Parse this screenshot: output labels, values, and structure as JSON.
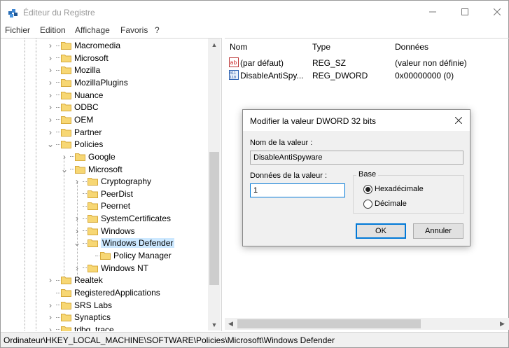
{
  "window": {
    "title": "Éditeur du Registre",
    "accent_color": "#0078d7"
  },
  "menu": [
    "Fichier",
    "Edition",
    "Affichage",
    "Favoris",
    "?"
  ],
  "tree": {
    "items": [
      {
        "label": "Macromedia",
        "expander": "collapsed"
      },
      {
        "label": "Microsoft",
        "expander": "collapsed"
      },
      {
        "label": "Mozilla",
        "expander": "collapsed"
      },
      {
        "label": "MozillaPlugins",
        "expander": "collapsed"
      },
      {
        "label": "Nuance",
        "expander": "collapsed"
      },
      {
        "label": "ODBC",
        "expander": "collapsed"
      },
      {
        "label": "OEM",
        "expander": "collapsed"
      },
      {
        "label": "Partner",
        "expander": "collapsed"
      },
      {
        "label": "Policies",
        "expander": "expanded"
      },
      {
        "label": "Google",
        "expander": "collapsed"
      },
      {
        "label": "Microsoft",
        "expander": "expanded"
      },
      {
        "label": "Cryptography",
        "expander": "collapsed"
      },
      {
        "label": "PeerDist",
        "expander": "none"
      },
      {
        "label": "Peernet",
        "expander": "none"
      },
      {
        "label": "SystemCertificates",
        "expander": "collapsed"
      },
      {
        "label": "Windows",
        "expander": "collapsed"
      },
      {
        "label": "Windows Defender",
        "expander": "expanded",
        "selected": true
      },
      {
        "label": "Policy Manager",
        "expander": "none"
      },
      {
        "label": "Windows NT",
        "expander": "collapsed"
      },
      {
        "label": "Realtek",
        "expander": "collapsed"
      },
      {
        "label": "RegisteredApplications",
        "expander": "none"
      },
      {
        "label": "SRS Labs",
        "expander": "collapsed"
      },
      {
        "label": "Synaptics",
        "expander": "collapsed"
      },
      {
        "label": "tdbg_trace",
        "expander": "collapsed"
      }
    ]
  },
  "list": {
    "columns": [
      "Nom",
      "Type",
      "Données"
    ],
    "rows": [
      {
        "icon": "string-value-icon",
        "name": "(par défaut)",
        "type": "REG_SZ",
        "data": "(valeur non définie)"
      },
      {
        "icon": "dword-value-icon",
        "name": "DisableAntiSpy...",
        "type": "REG_DWORD",
        "data": "0x00000000 (0)"
      }
    ]
  },
  "status_path": "Ordinateur\\HKEY_LOCAL_MACHINE\\SOFTWARE\\Policies\\Microsoft\\Windows Defender",
  "dialog": {
    "title": "Modifier la valeur DWORD 32 bits",
    "name_label": "Nom de la valeur :",
    "name_value": "DisableAntiSpyware",
    "data_label": "Données de la valeur :",
    "data_value": "1",
    "base_label": "Base",
    "hex_label": "Hexadécimale",
    "dec_label": "Décimale",
    "base_selected": "Hexadécimale",
    "ok_label": "OK",
    "cancel_label": "Annuler"
  }
}
